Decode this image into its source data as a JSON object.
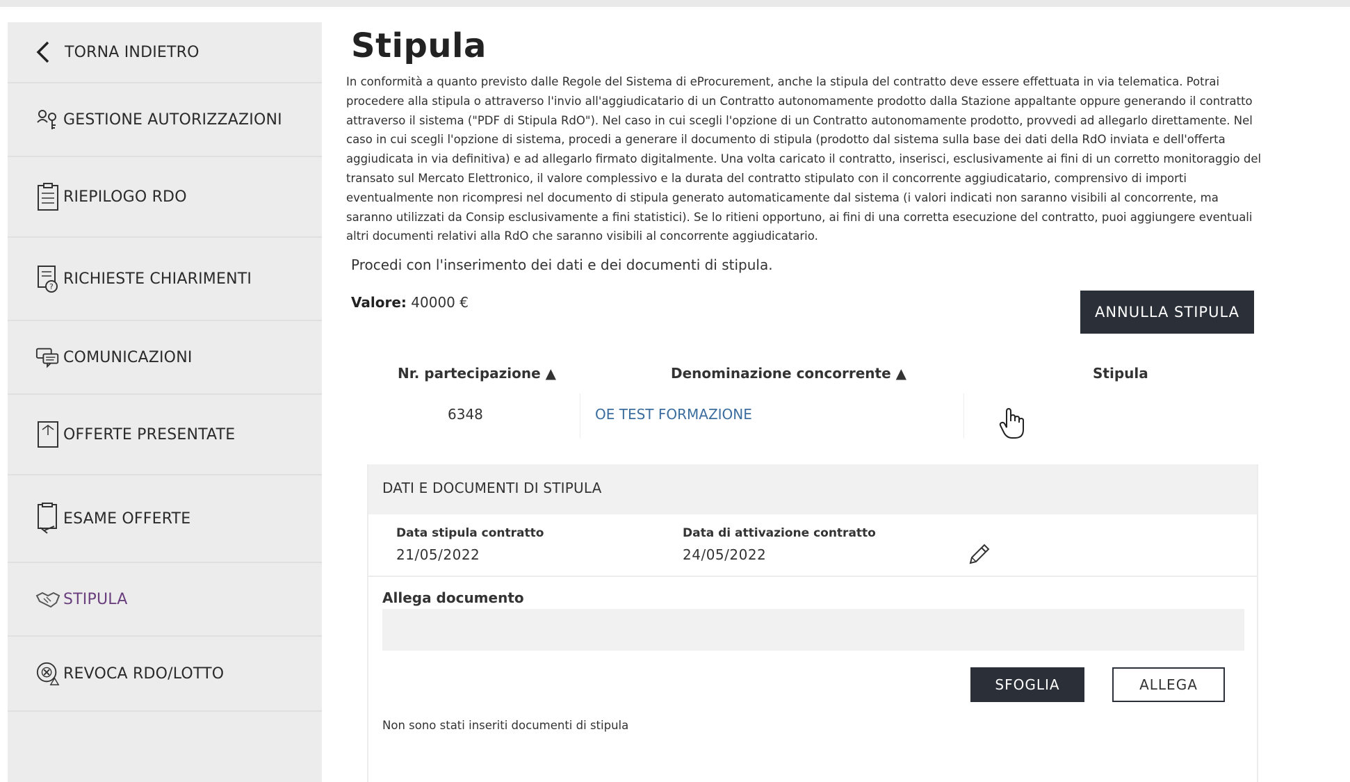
{
  "sidebar": {
    "back_label": "TORNA INDIETRO",
    "items": [
      {
        "label": "GESTIONE AUTORIZZAZIONI",
        "icon": "people-key-icon"
      },
      {
        "label": "RIEPILOGO RDO",
        "icon": "clipboard-icon"
      },
      {
        "label": "RICHIESTE CHIARIMENTI",
        "icon": "question-document-icon"
      },
      {
        "label": "COMUNICAZIONI",
        "icon": "chat-bubbles-icon"
      },
      {
        "label": "OFFERTE PRESENTATE",
        "icon": "offer-document-icon"
      },
      {
        "label": "ESAME OFFERTE",
        "icon": "review-document-icon"
      },
      {
        "label": "STIPULA",
        "icon": "handshake-icon",
        "active": true
      },
      {
        "label": "REVOCA RDO/LOTTO",
        "icon": "revoke-icon"
      }
    ],
    "active_color": "#6a3f7e"
  },
  "main": {
    "title": "Stipula",
    "intro": "In conformità a quanto previsto dalle Regole del Sistema di eProcurement, anche la stipula del contratto deve essere effettuata in via telematica. Potrai procedere alla stipula o attraverso l'invio all'aggiudicatario di un Contratto autonomamente prodotto dalla Stazione appaltante oppure generando il contratto attraverso il sistema (\"PDF di Stipula RdO\"). Nel caso in cui scegli l'opzione di un Contratto autonomamente prodotto, provvedi ad allegarlo direttamente. Nel caso in cui scegli l'opzione di sistema, procedi a generare il documento di stipula (prodotto dal sistema sulla base dei dati della RdO inviata e dell'offerta aggiudicata in via definitiva) e ad allegarlo firmato digitalmente. Una volta caricato il contratto, inserisci, esclusivamente ai fini di un corretto monitoraggio del transato sul Mercato Elettronico, il valore complessivo e la durata del contratto stipulato con il concorrente aggiudicatario, comprensivo di importi eventualmente non ricompresi nel documento di stipula generato automaticamente dal sistema (i valori indicati non saranno visibili al concorrente, ma saranno utilizzati da Consip esclusivamente a fini statistici). Se lo ritieni opportuno, ai fini di una corretta esecuzione del contratto, puoi aggiungere eventuali altri documenti relativi alla RdO che saranno visibili al concorrente aggiudicatario.",
    "procedi": "Procedi con l'inserimento dei dati e dei documenti di stipula.",
    "valore_label": "Valore:",
    "valore_value": "40000 €",
    "annulla_label": "ANNULLA STIPULA",
    "table": {
      "headers": [
        "Nr. partecipazione ▲",
        "Denominazione concorrente ▲",
        "Stipula"
      ],
      "row": {
        "nr": "6348",
        "denominazione": "OE TEST FORMAZIONE"
      }
    },
    "panel": {
      "title": "DATI E DOCUMENTI DI STIPULA",
      "data_stipula_label": "Data stipula contratto",
      "data_stipula_value": "21/05/2022",
      "data_attivazione_label": "Data di attivazione contratto",
      "data_attivazione_value": "24/05/2022",
      "edit_icon": "pencil-icon",
      "allega_documento_label": "Allega documento",
      "sfoglia_label": "SFOGLIA",
      "allega_label": "ALLEGA",
      "no_docs": "Non sono stati inseriti documenti di stipula"
    },
    "link_color": "#3b6d9e",
    "dark_button_color": "#2b3038"
  }
}
